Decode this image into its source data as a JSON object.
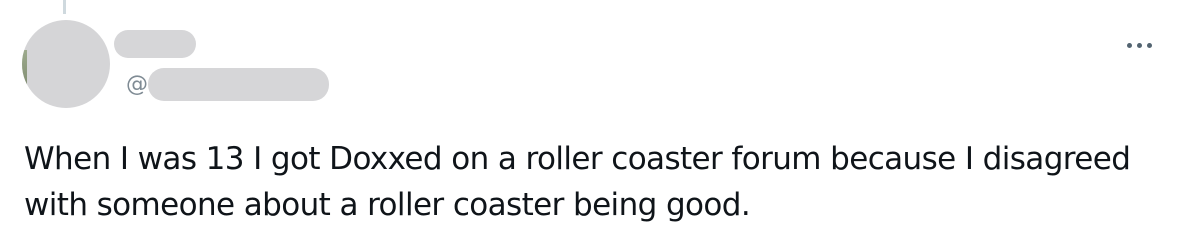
{
  "author": {
    "handle_prefix": "@"
  },
  "post": {
    "text_line_1": "When I was 13 I got Doxxed on a roller coaster forum because I disagreed",
    "text_line_2": "with someone about a roller coaster being good."
  },
  "icons": {
    "more": "more-horizontal-icon"
  },
  "colors": {
    "text": "#0f1419",
    "secondary": "#536471",
    "redaction": "#d6d6d8",
    "thread_line": "#cfd9de"
  }
}
